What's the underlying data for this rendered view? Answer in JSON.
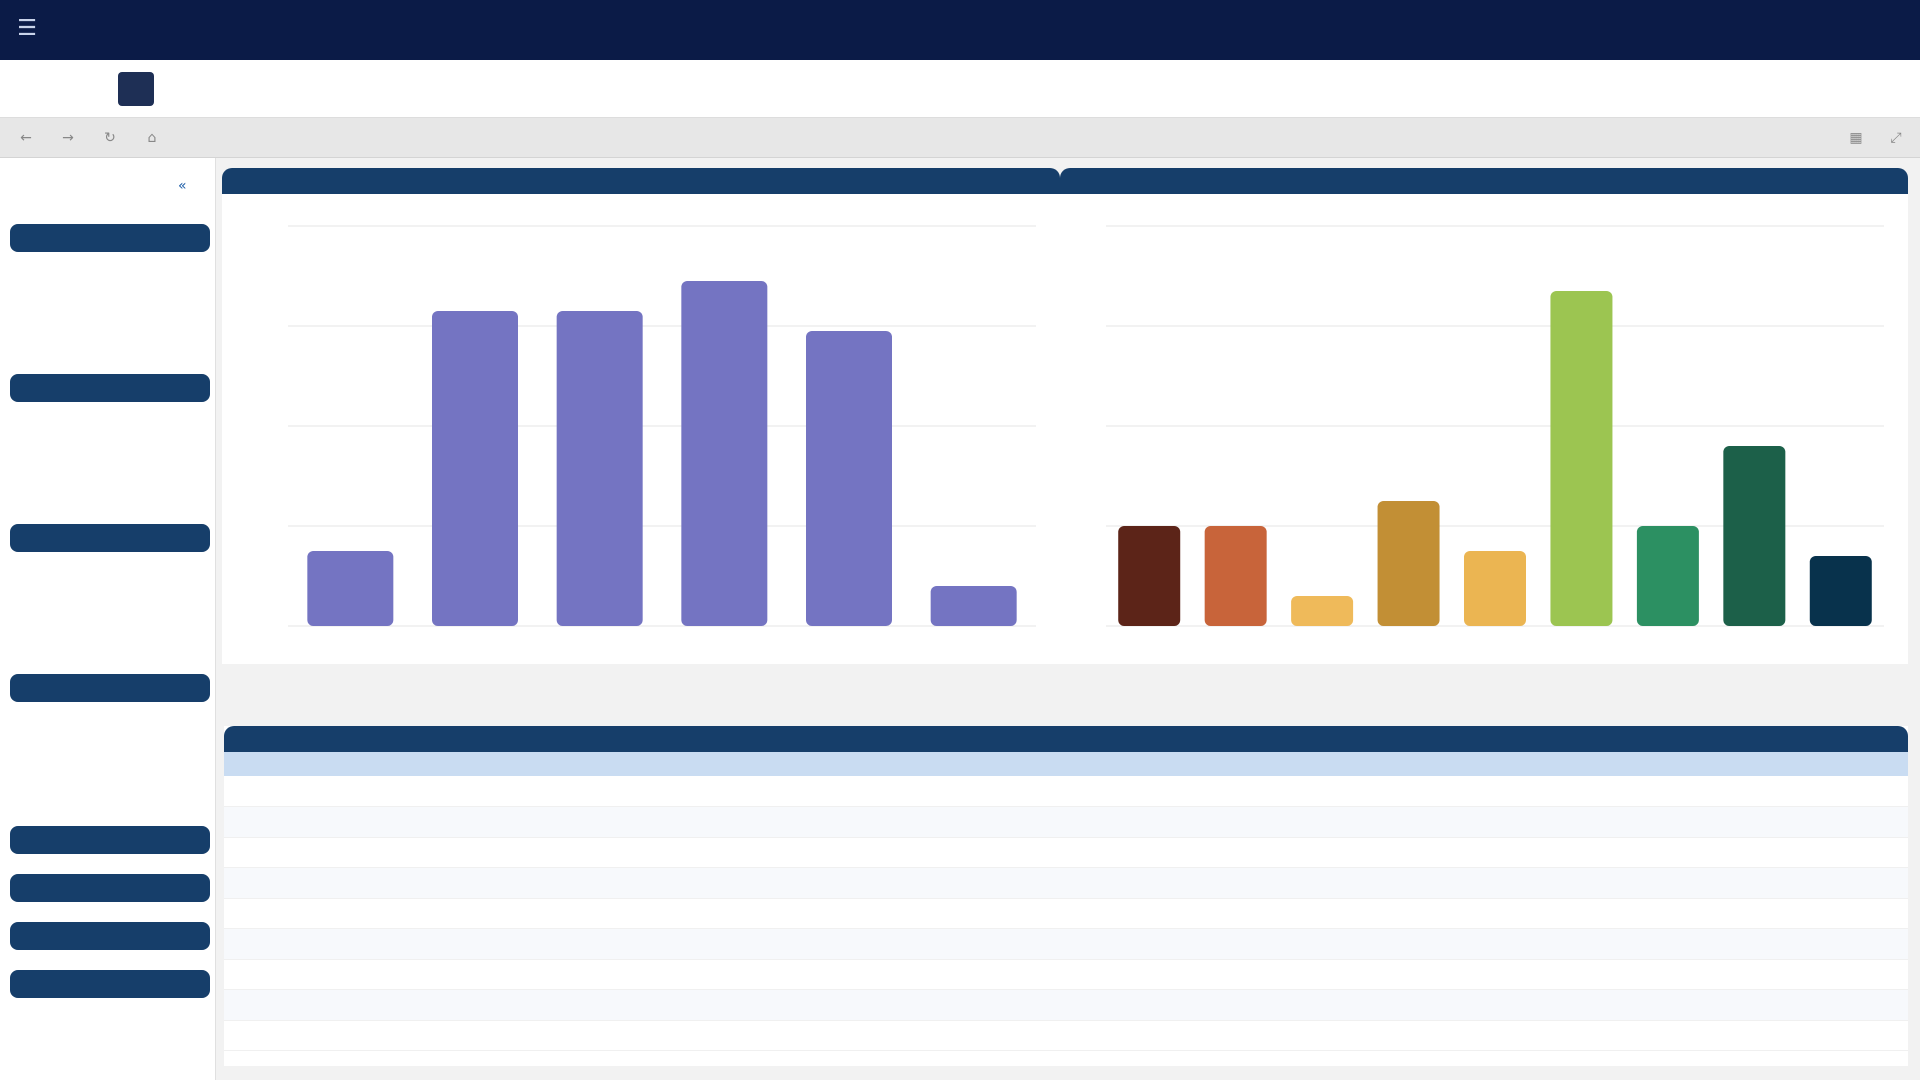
{
  "nav": {
    "items": [
      "",
      "",
      "",
      "",
      "",
      "",
      "",
      "",
      ""
    ],
    "right_items": [
      "",
      "",
      "",
      "",
      ""
    ]
  },
  "modebar": {
    "tabs": [
      "",
      ""
    ],
    "right_links": [
      "",
      ""
    ]
  },
  "breadcrumb": {
    "text": ""
  },
  "sidebar": {
    "header": "",
    "sections": [
      {
        "label": "",
        "items": [
          "",
          ""
        ]
      },
      {
        "label": "",
        "items": [
          "",
          ""
        ]
      },
      {
        "label": "",
        "items": [
          "",
          "",
          ""
        ]
      },
      {
        "label": "",
        "items": [
          "",
          "",
          ""
        ]
      },
      {
        "label": "",
        "items": []
      },
      {
        "label": "",
        "items": []
      },
      {
        "label": "",
        "items": []
      },
      {
        "label": "",
        "items": []
      }
    ]
  },
  "chart_data": [
    {
      "type": "bar",
      "title": "",
      "categories": [
        "",
        "",
        "",
        "",
        "",
        ""
      ],
      "values": [
        75,
        315,
        315,
        345,
        295,
        40
      ],
      "ylim": [
        0,
        400
      ],
      "yticks": [
        "",
        "",
        "",
        "",
        ""
      ],
      "grid": true,
      "colors": [
        "#7474c2"
      ]
    },
    {
      "type": "bar",
      "title": "",
      "categories": [
        "",
        "",
        "",
        "",
        "",
        "",
        "",
        "",
        ""
      ],
      "values": [
        1,
        1,
        0.3,
        1.25,
        0.75,
        3.35,
        1,
        1.8,
        0.7
      ],
      "ylim": [
        0,
        4
      ],
      "yticks": [
        "",
        "",
        "",
        "",
        ""
      ],
      "grid": true,
      "colors": [
        "#5c2418",
        "#c8643a",
        "#efba5a",
        "#c28f35",
        "#ebb552",
        "#9cc551",
        "#2c9062",
        "#1c6049",
        "#08324c"
      ]
    }
  ],
  "pager": {
    "prev": "",
    "next": ""
  },
  "table": {
    "title": "",
    "columns": [
      "",
      "",
      "",
      "",
      "",
      "",
      "",
      "",
      ""
    ],
    "rows": [
      [
        "",
        "",
        "",
        "",
        "",
        "",
        "",
        "",
        ""
      ],
      [
        "",
        "",
        "",
        "",
        "",
        "",
        "",
        "",
        ""
      ],
      [
        "",
        "",
        "",
        "",
        "",
        "",
        "",
        "",
        ""
      ],
      [
        "",
        "",
        "",
        "",
        "",
        "",
        "",
        "",
        ""
      ],
      [
        "",
        "",
        "",
        "",
        "",
        "",
        "",
        "",
        ""
      ],
      [
        "",
        "",
        "",
        "",
        "",
        "",
        "",
        "",
        ""
      ],
      [
        "",
        "",
        "",
        "",
        "",
        "",
        "",
        "",
        ""
      ],
      [
        "",
        "",
        "",
        "",
        "",
        "",
        "",
        "",
        ""
      ],
      [
        "",
        "",
        "",
        "",
        "",
        "",
        "",
        "",
        ""
      ]
    ]
  },
  "icons": {
    "menu": "menu-icon",
    "back": "arrow-left-icon",
    "forward": "arrow-right-icon",
    "refresh": "refresh-icon",
    "home": "home-icon",
    "grid_view": "grid-icon",
    "expand": "expand-icon",
    "collapse_sidebar": "chevron-left-icon"
  }
}
